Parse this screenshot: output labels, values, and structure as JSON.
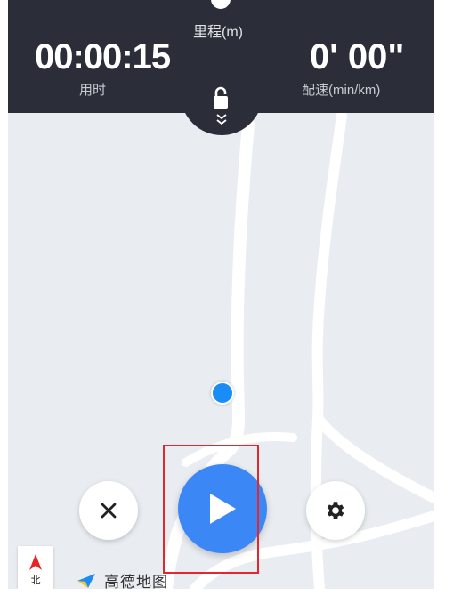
{
  "stats": {
    "duration_value": "00:00:15",
    "duration_label": "用时",
    "distance_label": "里程(m)",
    "pace_value": "0' 00\"",
    "pace_label": "配速(min/km)"
  },
  "compass": {
    "label": "北"
  },
  "map": {
    "provider_logo_text": "高德地图"
  },
  "icons": {
    "lock": "lock-icon",
    "expand": "double-chevron-down-icon",
    "close": "close-icon",
    "play": "play-icon",
    "settings": "gear-icon",
    "compass": "north-arrow-icon"
  },
  "colors": {
    "header_bg": "#2b2e38",
    "map_bg": "#e9ecf1",
    "accent_blue": "#3a87f5",
    "location_dot": "#1a8cf7",
    "highlight": "#e0282e",
    "compass_arrow": "#e8222a"
  }
}
